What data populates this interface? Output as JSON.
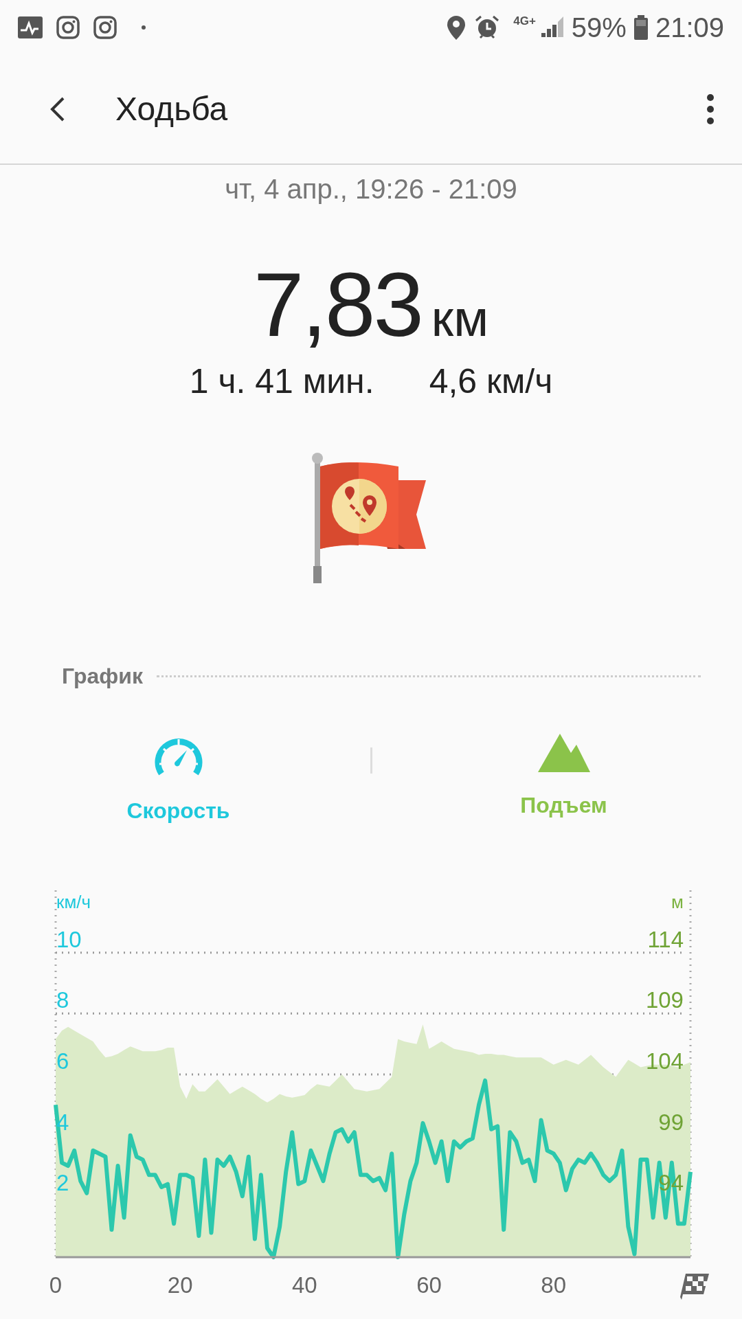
{
  "status_bar": {
    "network": "4G+",
    "battery": "59%",
    "time": "21:09"
  },
  "app_bar": {
    "title": "Ходьба"
  },
  "workout": {
    "date_range": "чт, 4 апр., 19:26 - 21:09",
    "distance": "7,83",
    "distance_unit": "км",
    "duration": "1 ч. 41 мин.",
    "avg_speed": "4,6 км/ч"
  },
  "graph_section": {
    "title": "График",
    "tabs": [
      {
        "label": "Скорость",
        "kind": "speed",
        "color": "#1ec8dc"
      },
      {
        "label": "Подъем",
        "kind": "elevation",
        "color": "#8bc34a"
      }
    ],
    "chart_data": {
      "type": "line",
      "grid": true,
      "ylabel": "км/ч",
      "y2label": "м",
      "xlim": [
        0,
        102
      ],
      "ylim": [
        0,
        12
      ],
      "y2lim": [
        89,
        119
      ],
      "xticks": [
        0,
        20,
        40,
        60,
        80
      ],
      "yticks": [
        2,
        4,
        6,
        8,
        10
      ],
      "y2ticks": [
        94,
        99,
        104,
        109,
        114
      ],
      "x": [
        0,
        1,
        2,
        3,
        4,
        5,
        6,
        7,
        8,
        9,
        10,
        11,
        12,
        13,
        14,
        15,
        16,
        17,
        18,
        19,
        20,
        21,
        22,
        23,
        24,
        25,
        26,
        27,
        28,
        29,
        30,
        31,
        32,
        33,
        34,
        35,
        36,
        37,
        38,
        39,
        40,
        41,
        42,
        43,
        44,
        45,
        46,
        47,
        48,
        49,
        50,
        51,
        52,
        53,
        54,
        55,
        56,
        57,
        58,
        59,
        60,
        61,
        62,
        63,
        64,
        65,
        66,
        67,
        68,
        69,
        70,
        71,
        72,
        73,
        74,
        75,
        76,
        77,
        78,
        79,
        80,
        81,
        82,
        83,
        84,
        85,
        86,
        87,
        88,
        89,
        90,
        91,
        92,
        93,
        94,
        95,
        96,
        97,
        98,
        99,
        100,
        101,
        102
      ],
      "series": [
        {
          "type": "area",
          "axis": "y2",
          "color": "#dcebc8",
          "values": [
            106.9,
            107.6,
            107.9,
            107.6,
            107.3,
            107.0,
            106.7,
            106.0,
            105.4,
            105.5,
            105.7,
            106.0,
            106.3,
            106.1,
            105.9,
            105.9,
            105.9,
            106.0,
            106.2,
            106.2,
            103.0,
            102.0,
            103.2,
            102.6,
            102.6,
            103.1,
            103.6,
            103.0,
            102.4,
            102.7,
            103.0,
            102.7,
            102.4,
            102.0,
            101.7,
            102.0,
            102.4,
            102.2,
            102.1,
            102.2,
            102.3,
            102.8,
            103.2,
            103.1,
            103.0,
            103.5,
            104.0,
            103.4,
            102.8,
            102.7,
            102.6,
            102.7,
            102.8,
            103.3,
            103.8,
            106.9,
            106.7,
            106.6,
            106.5,
            108.1,
            106.1,
            106.4,
            106.7,
            106.4,
            106.1,
            106.0,
            105.9,
            105.8,
            105.6,
            105.7,
            105.7,
            105.6,
            105.6,
            105.5,
            105.4,
            105.4,
            105.4,
            105.4,
            105.4,
            105.1,
            104.8,
            105.0,
            105.2,
            105.0,
            104.8,
            105.2,
            105.6,
            105.1,
            104.6,
            104.2,
            103.8,
            104.5,
            105.2,
            104.9,
            104.6,
            104.7,
            104.8,
            104.8,
            104.8,
            104.7,
            104.6,
            104.8,
            105.0
          ]
        },
        {
          "type": "line",
          "color": "#2cc8ad",
          "values": [
            5.0,
            3.1,
            3.0,
            3.5,
            2.5,
            2.1,
            3.5,
            3.4,
            3.3,
            0.9,
            3.0,
            1.3,
            4.0,
            3.3,
            3.2,
            2.7,
            2.7,
            2.3,
            2.4,
            1.1,
            2.7,
            2.7,
            2.6,
            0.7,
            3.2,
            0.8,
            3.2,
            3.0,
            3.3,
            2.8,
            2.0,
            3.3,
            0.6,
            2.7,
            0.3,
            0,
            1.0,
            2.8,
            4.1,
            2.4,
            2.5,
            3.5,
            3.0,
            2.5,
            3.4,
            4.1,
            4.2,
            3.8,
            4.1,
            2.7,
            2.7,
            2.5,
            2.6,
            2.2,
            3.4,
            0,
            1.4,
            2.5,
            3.1,
            4.4,
            3.8,
            3.1,
            3.8,
            2.5,
            3.8,
            3.6,
            3.8,
            3.9,
            5.0,
            5.8,
            4.2,
            4.3,
            0.9,
            4.1,
            3.8,
            3.1,
            3.2,
            2.5,
            4.5,
            3.5,
            3.4,
            3.1,
            2.2,
            2.9,
            3.2,
            3.1,
            3.4,
            3.1,
            2.7,
            2.5,
            2.7,
            3.5,
            1.0,
            0.1,
            3.2,
            3.2,
            1.3,
            3.1,
            1.3,
            3.1,
            1.1,
            1.1,
            2.8
          ]
        }
      ]
    }
  }
}
